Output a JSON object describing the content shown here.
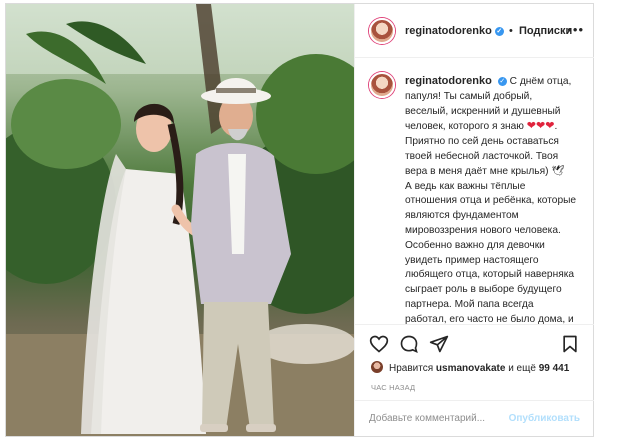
{
  "post": {
    "username": "reginatodorenko",
    "verified_icon": "verified-badge-icon",
    "separator": "•",
    "follow_label": "Подписки",
    "more_icon": "more-options-icon",
    "caption": {
      "line1": "С днём отца, папуля! Ты самый добрый, веселый, искренний и душевный человек, которого я знаю",
      "hearts": "❤❤❤",
      "line2": ". Приятно по сей день оставаться твоей небесной ласточкой. Твоя вера в меня даёт мне крылья)",
      "swallow": "🕊",
      "para2": "А ведь как важны тёплые отношения отца и ребёнка, которые являются фундаментом мировоззрения нового человека. Особенно важно для девочки увидеть пример настоящего любящего отца, который наверняка сыграет роль в выборе будущего партнера. Мой папа всегда работал, его часто не было дома, и , конечно же, мне не хватало его, но при всей загруженности, он всегда мчался с"
    },
    "likes": {
      "prefix": "Нравится",
      "user": "usmanovakate",
      "middle": "и ещё",
      "count": "99 441"
    },
    "timestamp": "ЧАС НАЗАД",
    "comment_placeholder": "Добавьте комментарий...",
    "publish_label": "Опубликовать",
    "colors": {
      "verified": "#3897f0",
      "heart": "#e0243d",
      "publish_disabled": "#b2dffc",
      "border": "#dbdbdb"
    }
  }
}
